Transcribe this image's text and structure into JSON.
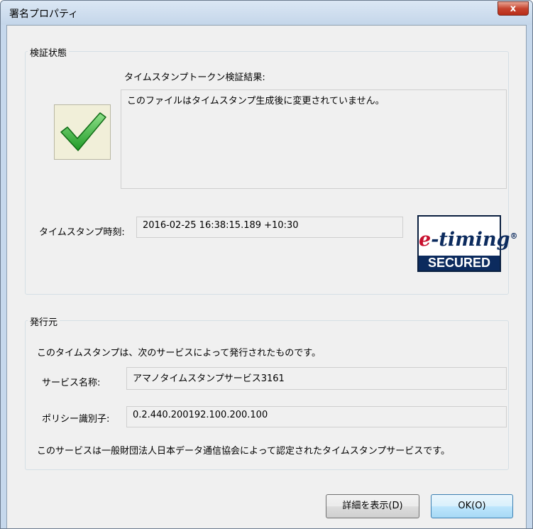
{
  "window": {
    "title": "署名プロパティ",
    "close_label": "x"
  },
  "verification": {
    "group_label": "検証状態",
    "result_heading": "タイムスタンプトークン検証結果:",
    "result_text": "このファイルはタイムスタンプ生成後に変更されていません。",
    "timestamp_label": "タイムスタンプ時刻:",
    "timestamp_value": "2016-02-25 16:38:15.189 +10:30",
    "status_icon": "checkmark-icon",
    "status_color": "#2fae2f",
    "logo": {
      "e": "e",
      "timing": "-timing",
      "reg": "®",
      "secured": "SECURED"
    }
  },
  "issuer": {
    "group_label": "発行元",
    "intro": "このタイムスタンプは、次のサービスによって発行されたものです。",
    "service_name_label": "サービス名称:",
    "service_name_value": "アマノタイムスタンプサービス3161",
    "policy_label": "ポリシー識別子:",
    "policy_value": "0.2.440.200192.100.200.100",
    "certification": "このサービスは一般財団法人日本データ通信協会によって認定されたタイムスタンプサービスです。"
  },
  "buttons": {
    "details": "詳細を表示(D)",
    "ok": "OK(O)"
  }
}
